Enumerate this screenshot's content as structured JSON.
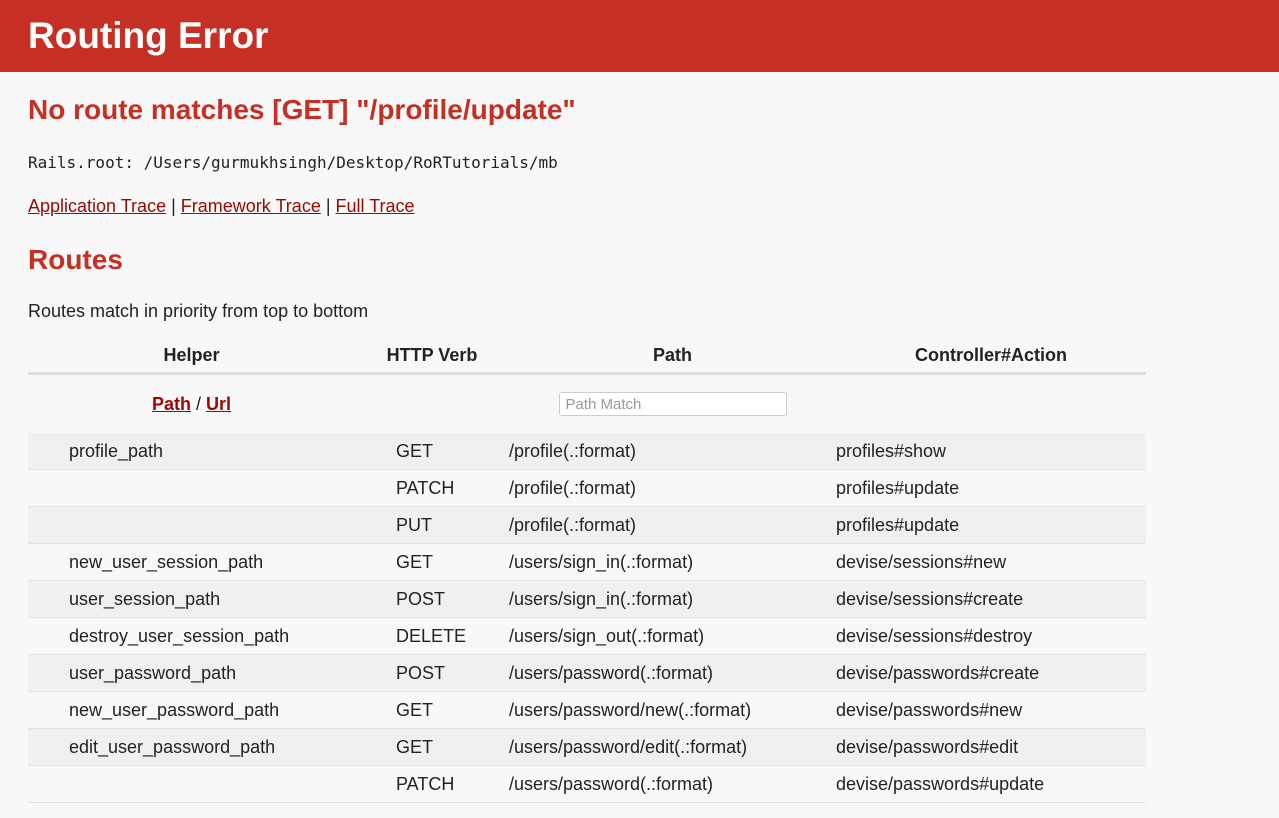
{
  "header": {
    "title": "Routing Error"
  },
  "error": {
    "message": "No route matches [GET] \"/profile/update\"",
    "rails_root": "Rails.root: /Users/gurmukhsingh/Desktop/RoRTutorials/mb"
  },
  "traces": {
    "application": "Application Trace",
    "framework": "Framework Trace",
    "full": "Full Trace",
    "separator": "|"
  },
  "routes": {
    "title": "Routes",
    "description": "Routes match in priority from top to bottom",
    "columns": {
      "helper": "Helper",
      "verb": "HTTP Verb",
      "path": "Path",
      "action": "Controller#Action"
    },
    "filter": {
      "path_link": "Path",
      "slash": "/",
      "url_link": "Url",
      "placeholder": "Path Match"
    },
    "rows": [
      {
        "helper": "profile_path",
        "verb": "GET",
        "path": "/profile(.:format)",
        "action": "profiles#show"
      },
      {
        "helper": "",
        "verb": "PATCH",
        "path": "/profile(.:format)",
        "action": "profiles#update"
      },
      {
        "helper": "",
        "verb": "PUT",
        "path": "/profile(.:format)",
        "action": "profiles#update"
      },
      {
        "helper": "new_user_session_path",
        "verb": "GET",
        "path": "/users/sign_in(.:format)",
        "action": "devise/sessions#new"
      },
      {
        "helper": "user_session_path",
        "verb": "POST",
        "path": "/users/sign_in(.:format)",
        "action": "devise/sessions#create"
      },
      {
        "helper": "destroy_user_session_path",
        "verb": "DELETE",
        "path": "/users/sign_out(.:format)",
        "action": "devise/sessions#destroy"
      },
      {
        "helper": "user_password_path",
        "verb": "POST",
        "path": "/users/password(.:format)",
        "action": "devise/passwords#create"
      },
      {
        "helper": "new_user_password_path",
        "verb": "GET",
        "path": "/users/password/new(.:format)",
        "action": "devise/passwords#new"
      },
      {
        "helper": "edit_user_password_path",
        "verb": "GET",
        "path": "/users/password/edit(.:format)",
        "action": "devise/passwords#edit"
      },
      {
        "helper": "",
        "verb": "PATCH",
        "path": "/users/password(.:format)",
        "action": "devise/passwords#update"
      }
    ]
  }
}
